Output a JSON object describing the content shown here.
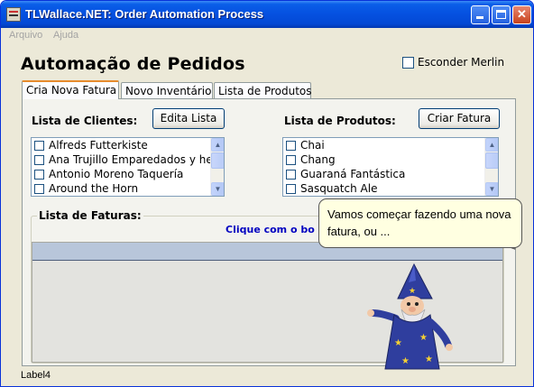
{
  "window": {
    "title": "TLWallace.NET: Order Automation Process"
  },
  "menu": {
    "items": [
      "Arquivo",
      "Ajuda"
    ]
  },
  "header": {
    "title": "Automação de Pedidos",
    "hide_merlin_label": "Esconder Merlin",
    "hide_merlin_checked": false
  },
  "tabs": [
    {
      "label": "Cria Nova Fatura",
      "active": true
    },
    {
      "label": "Novo Inventário",
      "active": false
    },
    {
      "label": "Lista de Produtos",
      "active": false
    }
  ],
  "customers": {
    "label": "Lista de Clientes:",
    "edit_button": "Edita Lista",
    "items": [
      "Alfreds Futterkiste",
      "Ana Trujillo Emparedados y he",
      "Antonio Moreno Taquería",
      "Around the Horn"
    ]
  },
  "products": {
    "label": "Lista de Produtos:",
    "create_button": "Criar Fatura",
    "items": [
      "Chai",
      "Chang",
      "Guaraná Fantástica",
      "Sasquatch Ale"
    ]
  },
  "invoices": {
    "label": "Lista de Faturas:",
    "hint": "Clique com o bo"
  },
  "balloon": {
    "text": "Vamos começar fazendo uma nova fatura, ou ..."
  },
  "status": {
    "text": "Label4"
  },
  "colors": {
    "titlebar": "#0550e0",
    "window_bg": "#ece9d8",
    "hint_text": "#0000c0",
    "grid_header": "#b8c6da",
    "balloon_bg": "#ffffe1",
    "active_tab_accent": "#e68b2c"
  },
  "icons": {
    "app": "app-window-icon",
    "minimize": "minimize-icon",
    "maximize": "maximize-icon",
    "close": "close-icon",
    "merlin": "merlin-wizard-character"
  }
}
